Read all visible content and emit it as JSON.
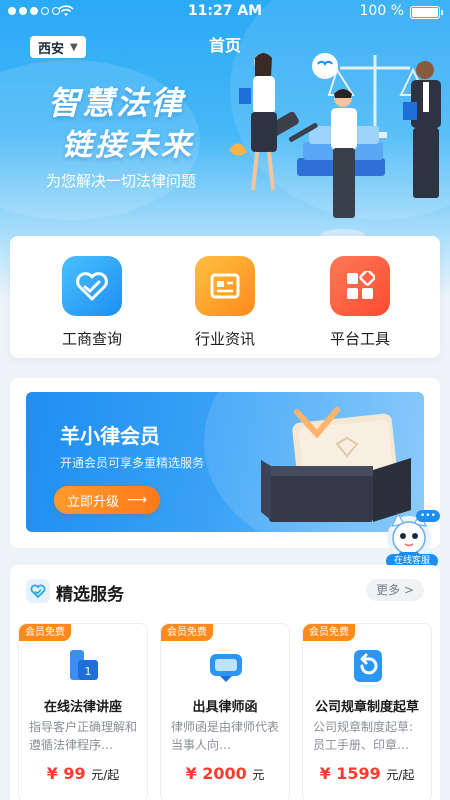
{
  "status_bar": {
    "time": "11:27 AM",
    "battery": "100 %"
  },
  "nav": {
    "city": "西安",
    "title": "首页"
  },
  "hero": {
    "line1": "智慧法律",
    "line2": "链接未来",
    "subtitle": "为您解决一切法律问题"
  },
  "quick_actions": [
    {
      "label": "工商查询",
      "icon": "heart-handshake-icon",
      "color": "#2aa6f2"
    },
    {
      "label": "行业资讯",
      "icon": "news-icon",
      "color": "#ff9a1f"
    },
    {
      "label": "平台工具",
      "icon": "tools-grid-icon",
      "color": "#ff5a3c"
    }
  ],
  "member": {
    "title": "羊小律会员",
    "subtitle": "开通会员可享多重精选服务",
    "button": "立即升级"
  },
  "kefu": {
    "label": "在线客服",
    "dots": "•••"
  },
  "services": {
    "title": "精选服务",
    "more": "更多 >",
    "items": [
      {
        "badge": "会员免费",
        "name": "在线法律讲座",
        "desc": "指导客户正确理解和遵循法律程序…",
        "price": "¥ 99",
        "unit": "元/起",
        "icon": "lecture-icon"
      },
      {
        "badge": "会员免费",
        "name": "出具律师函",
        "desc": "律师函是由律师代表当事人向…",
        "price": "¥ 2000",
        "unit": "元",
        "icon": "vr-letter-icon"
      },
      {
        "badge": "会员免费",
        "name": "公司规章制度起草",
        "desc": "公司规章制度起草: 员工手册、印章…",
        "price": "¥ 1599",
        "unit": "元/起",
        "icon": "undo-document-icon"
      }
    ]
  },
  "colors": {
    "primary": "#1e8ef0",
    "accent": "#ff8a1c",
    "price": "#ff3b30"
  }
}
